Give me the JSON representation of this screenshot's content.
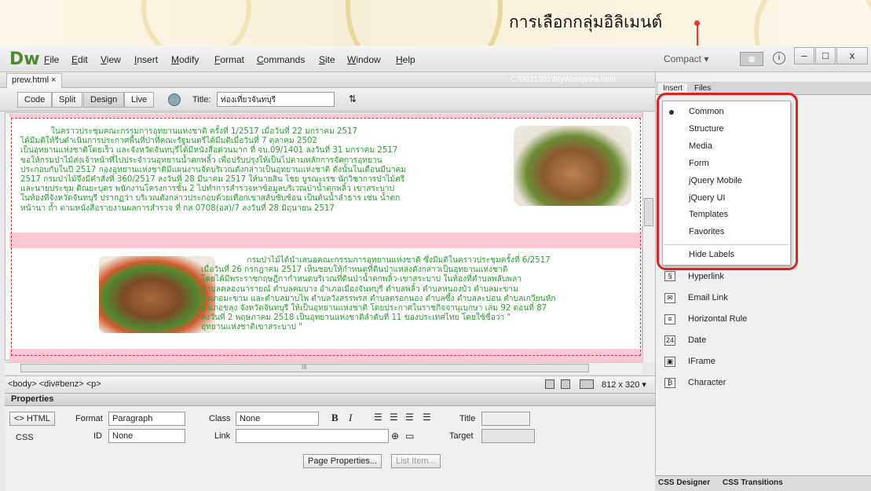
{
  "callout": "การเลือกกลุ่มอิลิเมนต์",
  "app": {
    "logo": "Dw",
    "menu": [
      {
        "underline": "F",
        "rest": "ile"
      },
      {
        "underline": "E",
        "rest": "dit"
      },
      {
        "underline": "V",
        "rest": "iew"
      },
      {
        "underline": "I",
        "rest": "nsert"
      },
      {
        "underline": "M",
        "rest": "odify"
      },
      {
        "underline": "F",
        "rest": "ormat",
        "pre": ""
      },
      {
        "underline": "C",
        "rest": "ommands"
      },
      {
        "underline": "S",
        "rest": "ite"
      },
      {
        "underline": "W",
        "rest": "indow"
      },
      {
        "underline": "H",
        "rest": "elp"
      }
    ],
    "workspace": "Compact ▾",
    "win_min": "–",
    "win_max": "□",
    "win_close": "x"
  },
  "document": {
    "tab_name": "prew.html",
    "tab_close": "×",
    "path": "C:\\0031301\\MyWeb\\prew.html",
    "views": [
      "Code",
      "Split",
      "Design",
      "Live"
    ],
    "title_label": "Title:",
    "title_value": "ท่องเที่ยวจันทบุรี",
    "para1": "            ในคราวประชุมคณะกรรมการอุทยานแห่งชาติ ครั้งที่ 1/2517 เมื่อวันที่ 22 มกราคม 2517\nได้มีมติให้รีบดำเนินการประกาศพื้นที่ป่าที่คณะรัฐมนตรีได้มีมติเมื่อวันที่ 7 ตุลาคม 2502\nเป็นอุทยานแห่งชาติโดยเร็ว และจังหวัดจันทบุรีได้มีหนังสือด่วนมาก ที่ จบ.09/1401 ลงวันที่ 31 มกราคม 2517\nขอให้กรมป่าไม้ส่งเจ้าหน้าที่ไปประจำวนอุทยานน้ำตกพลิ้ว เพื่อปรับปรุงให้เป็นไปตามหลักการจัดการอุทยาน\nประกอบกับในปี 2517 กองอุทยานแห่งชาติมีแผนงานจัดบริเวณดังกล่าวเป็นอุทยานแห่งชาติ ดังนั้นในเดือนมีนาคม\n2517 กรมป่าไม้จึงมีคำสั่งที่ 360/2517 ลงวันที่ 28 มีนาคม 2517 ให้นายสิน ไชย บูรณะเรช นักวิชาการป่าไม้ตรี\nและนายประชุม ดิณยะบุตร พนักงานโครงการชั้น 2 ไปทำการสำรวจหาข้อมูลบริเวณป่าน้ำตกพลิ้ว เขาสระบาป\nในท้องที่จังหวัดจันทบุรี ปรากฏว่า บริเวณดังกล่าวประกอบด้วยเทือกเขาสลับซับซ้อน เป็นต้นน้ำลำธาร เช่น น้ำตก\nหน้านา ถ้ำ ตามหนังสือรายงานผลการสำรวจ ที่ กส 0708(อส)/7 ลงวันที่ 28 มิถุนายน 2517",
    "para2": "                  กรมป่าไม้ได้นำเสนอคณะกรรมการอุทยานแห่งชาติ ซึ่งมีมติในคราวประชุมครั้งที่ 6/2517\nเมื่อวันที่ 26 กรกฎาคม 2517 เห็นชอบให้กำหนดที่ดินป่าแหล่งดังกล่าวเป็นอุทยานแห่งชาติ\nโดยได้มีพระราชกฤษฎีกากำหนดบริเวณที่ดินป่าน้ำตกพลิ้ว-เขาสระบาป ในท้องที่ตำบลพลับพลา\nตำบลคลองนารายณ์ ตำบลคมบาง อำเภอเมืองจันทบุรี ตำบลพลิ้ว ตำบลหนองบัว ตำบลมะขาม\nอำเภอมะขาม และตำบลมาบไพ ตำบลวังสรรพรส ตำบลตรอกนอง ตำบลซึ้ง ตำบลละปอน ตำบลเกวียนหัก\nอำเภอขลุง จังหวัดจันทบุรี ให้เป็นอุทยานแห่งชาติ โดยประกาศในราชกิจจานุเบกษา เล่ม 92 ตอนที่ 87\nลงวันที่ 2 พฤษภาคม 2518 เป็นอุทยานแห่งชาติลำดับที่ 11 ของประเทศไทย โดยใช้ชื่อว่า \"\nอุทยานแห่งชาติเขาสระบาป \"",
    "hscroll_mark": "III"
  },
  "status": {
    "tag_selector": "<body> <div#benz> <p>",
    "window_size": "812 x 320 ▾"
  },
  "properties": {
    "title": "Properties",
    "html_btn": "<> HTML",
    "css_btn": "CSS",
    "format_label": "Format",
    "format_value": "Paragraph",
    "id_label": "ID",
    "id_value": "None",
    "class_label": "Class",
    "class_value": "None",
    "link_label": "Link",
    "title_label": "Title",
    "target_label": "Target",
    "bold": "B",
    "italic": "I",
    "page_properties": "Page Properties...",
    "list_item": "List Item..."
  },
  "panel": {
    "tabs": [
      "Insert",
      "Files"
    ],
    "dropdown": [
      "Common",
      "Structure",
      "Media",
      "Form",
      "jQuery Mobile",
      "jQuery UI",
      "Templates",
      "Favorites"
    ],
    "hide_labels": "Hide Labels",
    "items": [
      "Hyperlink",
      "Email Link",
      "Horizontal Rule",
      "Date",
      "IFrame",
      "Character"
    ],
    "bottom_tabs": [
      "CSS Designer",
      "CSS Transitions"
    ]
  }
}
